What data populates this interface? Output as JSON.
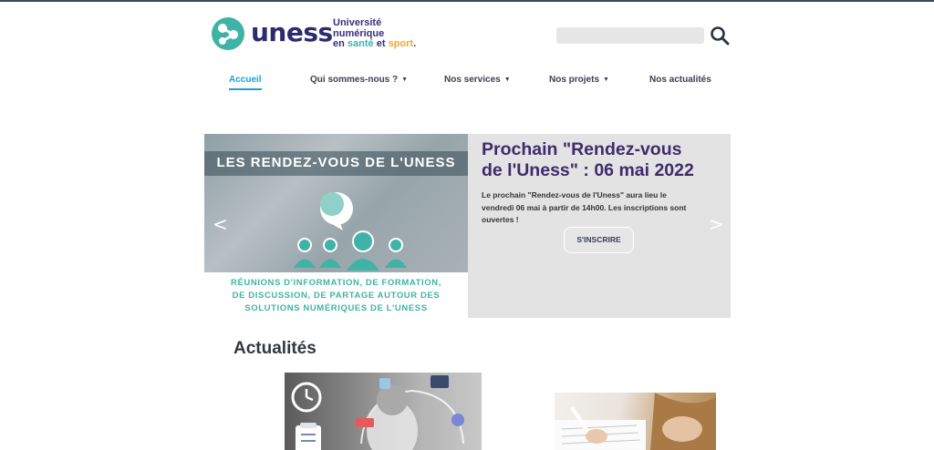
{
  "brand": {
    "name": "uness",
    "tagline_line1": "Université",
    "tagline_line2": "numérique",
    "tagline_en": "en",
    "tagline_sante": "santé",
    "tagline_et": "et",
    "tagline_sport": "sport",
    "tagline_dot": ".",
    "colors": {
      "purple": "#2f2a6e",
      "teal": "#3fb3a6",
      "orange": "#f2a531"
    }
  },
  "search": {
    "placeholder": "",
    "icon": "search-icon"
  },
  "nav": {
    "items": [
      {
        "label": "Accueil",
        "active": true,
        "has_dropdown": false
      },
      {
        "label": "Qui sommes-nous ?",
        "active": false,
        "has_dropdown": true
      },
      {
        "label": "Nos services",
        "active": false,
        "has_dropdown": true
      },
      {
        "label": "Nos projets",
        "active": false,
        "has_dropdown": true
      },
      {
        "label": "Nos actualités",
        "active": false,
        "has_dropdown": false
      }
    ],
    "caret": "▼",
    "active_color": "#1aa3d9"
  },
  "slider": {
    "image_heading": "LES RENDEZ-VOUS DE L'UNESS",
    "image_subtitle_line1": "RÉUNIONS D'INFORMATION, DE FORMATION,",
    "image_subtitle_line2": "DE DISCUSSION, DE PARTAGE AUTOUR DES",
    "image_subtitle_line3": "SOLUTIONS NUMÉRIQUES DE L'UNESS",
    "title_line1": "Prochain \"Rendez-vous",
    "title_line2": "de l'Uness\" : 06 mai 2022",
    "desc_line1": "Le prochain \"Rendez-vous de l'Uness\" aura lieu le",
    "desc_line2": "vendredi 06 mai à partir de 14h00. Les inscriptions sont",
    "desc_line3": "ouvertes !",
    "button_label": "S'INSCRIRE",
    "prev_arrow": "<",
    "next_arrow": ">"
  },
  "news": {
    "section_title": "Actualités"
  }
}
